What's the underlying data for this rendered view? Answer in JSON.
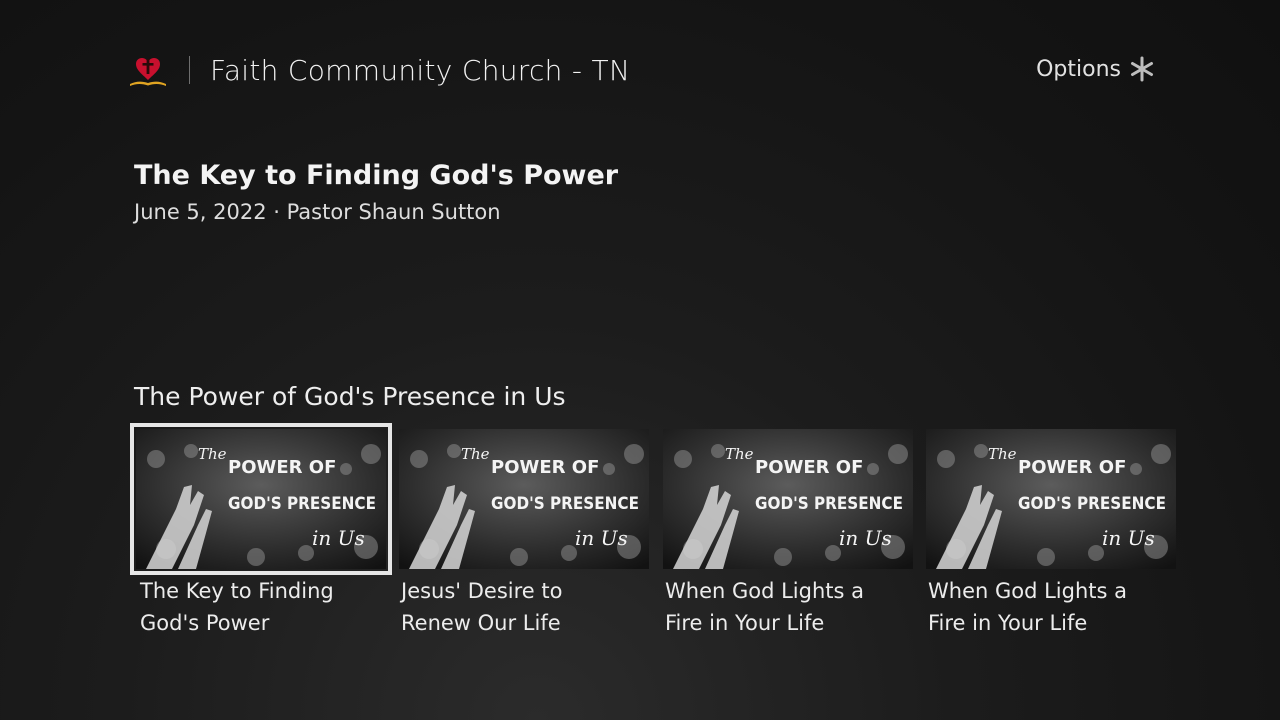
{
  "header": {
    "logo_icon": "heart-bible-logo-icon",
    "channel_title": "Faith Community Church - TN"
  },
  "options": {
    "label": "Options",
    "icon": "asterisk-icon"
  },
  "hero": {
    "title": "The Key to Finding God's Power",
    "meta": "June 5, 2022 · Pastor Shaun Sutton"
  },
  "row": {
    "title": "The Power of God's Presence in Us",
    "tiles": [
      {
        "label_line1": "The Key to Finding",
        "label_line2": "God's Power",
        "thumb": {
          "the": "The",
          "line1": "POWER OF",
          "line2": "GOD'S PRESENCE",
          "script": "in Us"
        },
        "focused": true
      },
      {
        "label_line1": "Jesus' Desire to",
        "label_line2": "Renew Our Life",
        "thumb": {
          "the": "The",
          "line1": "POWER OF",
          "line2": "GOD'S PRESENCE",
          "script": "in Us"
        },
        "focused": false
      },
      {
        "label_line1": "When God Lights a",
        "label_line2": "Fire in Your Life",
        "thumb": {
          "the": "The",
          "line1": "POWER OF",
          "line2": "GOD'S PRESENCE",
          "script": "in Us"
        },
        "focused": false
      },
      {
        "label_line1": "When God Lights a",
        "label_line2": "Fire in Your Life",
        "thumb": {
          "the": "The",
          "line1": "POWER OF",
          "line2": "GOD'S PRESENCE",
          "script": "in Us"
        },
        "focused": false
      }
    ]
  },
  "colors": {
    "background": "#141414",
    "focus_ring": "#e6e6e6",
    "logo_red": "#c8102e",
    "logo_gold": "#e0a422"
  }
}
